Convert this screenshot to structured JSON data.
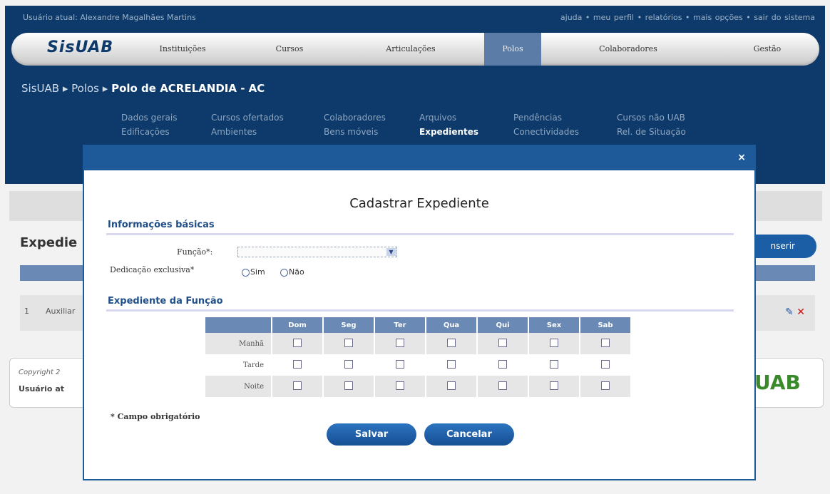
{
  "topbar": {
    "user_text": "Usuário atual: Alexandre Magalhães Martins",
    "links_text": "ajuda • meu perfil • relatórios • mais opções • sair do sistema"
  },
  "menu": {
    "logo": "SisUAB",
    "items": [
      "Instituições",
      "Cursos",
      "Articulações",
      "Polos",
      "Colaboradores",
      "Gestão"
    ],
    "active": "Polos"
  },
  "breadcrumb": {
    "root": "SisUAB",
    "section": "Polos",
    "current": "Polo de ACRELANDIA - AC"
  },
  "subnav": {
    "col1": [
      "Dados gerais",
      "Edificações"
    ],
    "col2": [
      "Cursos ofertados",
      "Ambientes"
    ],
    "col3": [
      "Colaboradores",
      "Bens móveis"
    ],
    "col4": [
      "Arquivos",
      "Expedientes"
    ],
    "col5": [
      "Pendências",
      "Conectividades"
    ],
    "col6": [
      "Cursos não UAB",
      "Rel. de Situação"
    ]
  },
  "background": {
    "title_partial": "Expedie",
    "insert_partial": "nserir",
    "row_num": "1",
    "row_text_partial": "Auxiliar",
    "footer_copyright_partial": "Copyright 2",
    "footer_user_partial": "Usuário at",
    "logo_partial": "UAB"
  },
  "modal": {
    "close": "×",
    "title": "Cadastrar Expediente",
    "section_basic": "Informações básicas",
    "funcao_label": "Função*:",
    "funcao_value": "",
    "dedicacao_label": "Dedicação exclusiva*",
    "radio_sim": "Sim",
    "radio_nao": "Não",
    "section_exp": "Expediente da Função",
    "days": [
      "Dom",
      "Seg",
      "Ter",
      "Qua",
      "Qui",
      "Sex",
      "Sab"
    ],
    "shifts": [
      "Manhã",
      "Tarde",
      "Noite"
    ],
    "required_note": "* Campo obrigatório",
    "save": "Salvar",
    "cancel": "Cancelar"
  }
}
